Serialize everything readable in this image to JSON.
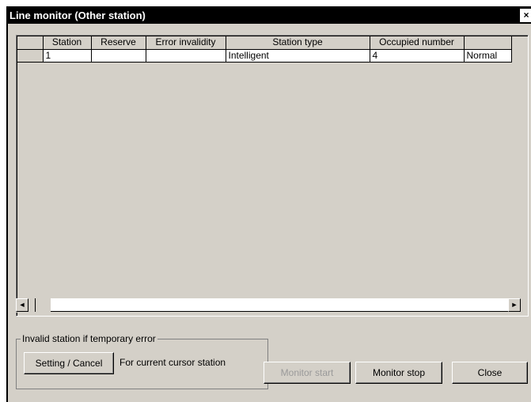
{
  "window": {
    "title": "Line monitor (Other station)",
    "close_glyph": "×"
  },
  "grid": {
    "columns": [
      "",
      "Station",
      "Reserve",
      "Error invalidity",
      "Station type",
      "Occupied number",
      ""
    ],
    "rows": [
      [
        "",
        "1",
        "",
        "",
        "Intelligent",
        "4",
        "Normal"
      ]
    ]
  },
  "scrollbar": {
    "left_arrow": "◄",
    "right_arrow": "►"
  },
  "invalid_group": {
    "legend": "Invalid station if temporary error",
    "setting_cancel_label": "Setting / Cancel",
    "note": "For current cursor station"
  },
  "buttons": {
    "monitor_start": "Monitor start",
    "monitor_stop": "Monitor stop",
    "close": "Close"
  }
}
